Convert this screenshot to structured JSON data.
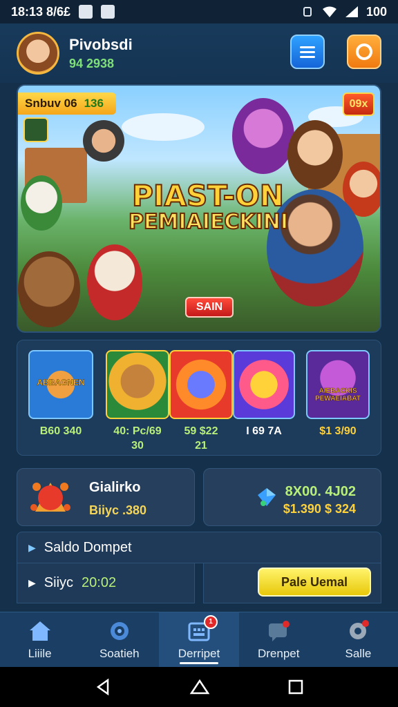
{
  "status_bar": {
    "time": "18:13 8/6£",
    "battery": "100"
  },
  "header": {
    "user_name": "Pivobsdi",
    "user_sub": "94 2938"
  },
  "banner": {
    "tag_label": "Snbuv 06",
    "tag_value": "136",
    "close_label": "09x",
    "title_line1": "PIAST-ON",
    "title_line2": "PEMIAIECKINI",
    "cta_label": "SAIN"
  },
  "games": [
    {
      "thumb_text": "ABBAGNEN",
      "label": "B60 340"
    },
    {
      "thumb_text": "",
      "label": "40: Pc/69\n30"
    },
    {
      "thumb_text": "",
      "label": "59 $22\n21"
    },
    {
      "thumb_text": "",
      "label": "I 69 7A"
    },
    {
      "thumb_text": "AIEBACKIS PEWAEIABAT",
      "label": "$1 3/90"
    }
  ],
  "info_card_left": {
    "title": "Gialirko",
    "sub": "Biiyc .380"
  },
  "info_card_right": {
    "line1": "8X00. 4J02",
    "line2": "$1.390 $ 324"
  },
  "wallet": {
    "title": "Saldo Dompet",
    "sub_label": "Siiyc",
    "sub_time": "20:02",
    "pay_button": "Pale Uemal"
  },
  "bottom_nav": [
    {
      "label": "Liiile",
      "icon": "home-icon",
      "badge": ""
    },
    {
      "label": "Soatieh",
      "icon": "search-icon",
      "badge": ""
    },
    {
      "label": "Derripet",
      "icon": "wallet-icon",
      "badge": "1"
    },
    {
      "label": "Drenpet",
      "icon": "chat-icon",
      "badge": ""
    },
    {
      "label": "Salle",
      "icon": "settings-icon",
      "badge": ""
    }
  ],
  "colors": {
    "background": "#14304a",
    "accent_green": "#b8f07a",
    "accent_yellow": "#ffd23a",
    "header_button_blue": "#1565d8",
    "header_button_orange": "#f07a10"
  }
}
